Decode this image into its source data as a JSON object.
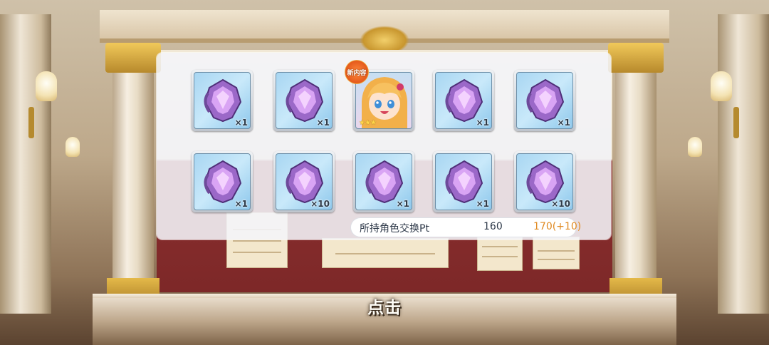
{
  "result": {
    "items": [
      {
        "kind": "gem",
        "qty": "×1"
      },
      {
        "kind": "gem",
        "qty": "×1"
      },
      {
        "kind": "character",
        "badge": "新内容",
        "stars": "★★★"
      },
      {
        "kind": "gem",
        "qty": "×1"
      },
      {
        "kind": "gem",
        "qty": "×1"
      },
      {
        "kind": "gem",
        "qty": "×1"
      },
      {
        "kind": "gem",
        "qty": "×10"
      },
      {
        "kind": "gem",
        "qty": "×1"
      },
      {
        "kind": "gem",
        "qty": "×1"
      },
      {
        "kind": "gem",
        "qty": "×10"
      }
    ],
    "points": {
      "label": "所持角色交换Pt",
      "current": "160",
      "after": "170(+10)"
    }
  },
  "tap_prompt": "点击",
  "colors": {
    "gem_primary": "#b07ae0",
    "points_gain": "#e08a22",
    "panel_bg": "#f4f5f9"
  },
  "icons": {
    "gem": "memory-piece-icon",
    "badge": "new-badge-icon"
  }
}
